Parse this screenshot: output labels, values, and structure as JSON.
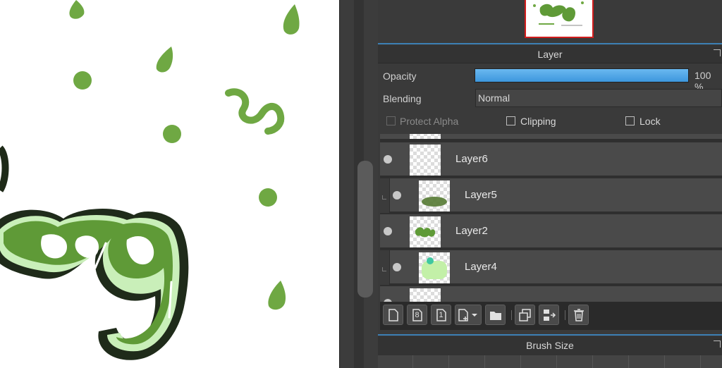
{
  "layer_panel": {
    "title": "Layer",
    "opacity_label": "Opacity",
    "opacity_value": "100 %",
    "opacity_fraction": 1.0,
    "blending_label": "Blending",
    "blending_value": "Normal",
    "protect_alpha_label": "Protect Alpha",
    "clipping_label": "Clipping",
    "lock_label": "Lock",
    "accent_color": "#3c97dd"
  },
  "layers": [
    {
      "name": "Layer6"
    },
    {
      "name": "Layer5"
    },
    {
      "name": "Layer2"
    },
    {
      "name": "Layer4"
    }
  ],
  "toolbar": {
    "icons": [
      "new-layer-icon",
      "new-8bit-layer-icon",
      "new-1bit-layer-icon",
      "add-layer-menu-icon",
      "new-folder-icon",
      "duplicate-layer-icon",
      "merge-down-icon",
      "delete-layer-icon"
    ],
    "bit8_label": "8",
    "bit1_label": "1"
  },
  "brush_panel": {
    "title": "Brush Size"
  },
  "canvas": {
    "art_color": "#6a9e3d"
  }
}
